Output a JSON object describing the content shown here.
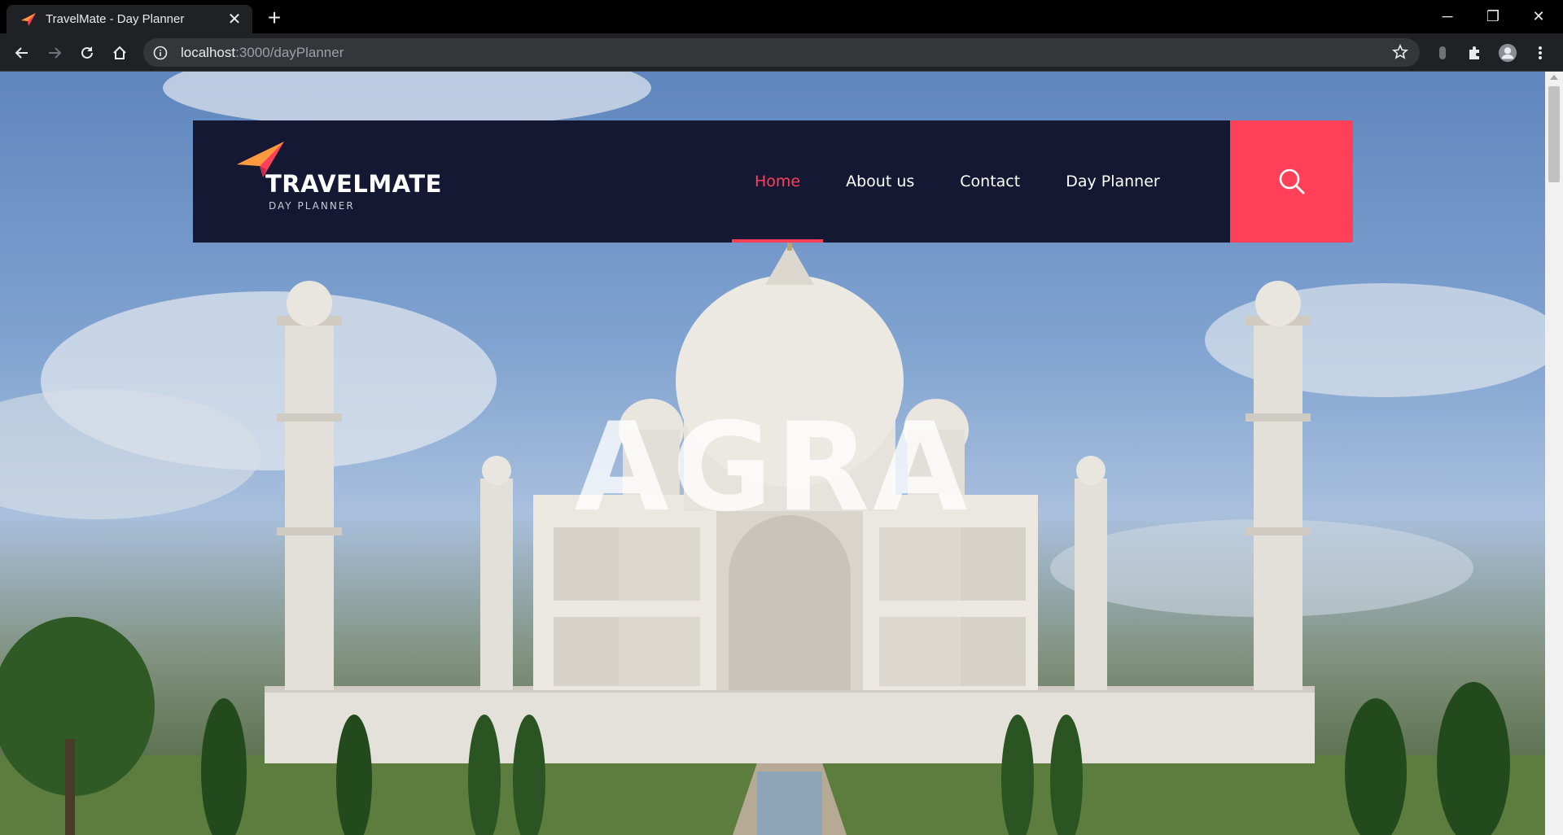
{
  "browser": {
    "tab_title": "TravelMate - Day Planner",
    "url_host": "localhost",
    "url_rest": ":3000/dayPlanner"
  },
  "site": {
    "logo_title": "TRAVELMATE",
    "logo_subtitle": "DAY PLANNER",
    "nav": [
      {
        "label": "Home",
        "active": true
      },
      {
        "label": "About us",
        "active": false
      },
      {
        "label": "Contact",
        "active": false
      },
      {
        "label": "Day Planner",
        "active": false
      }
    ],
    "search_icon": "search-icon",
    "accent_color": "#ff4058",
    "header_color": "#141832"
  },
  "hero": {
    "title": "AGRA"
  }
}
